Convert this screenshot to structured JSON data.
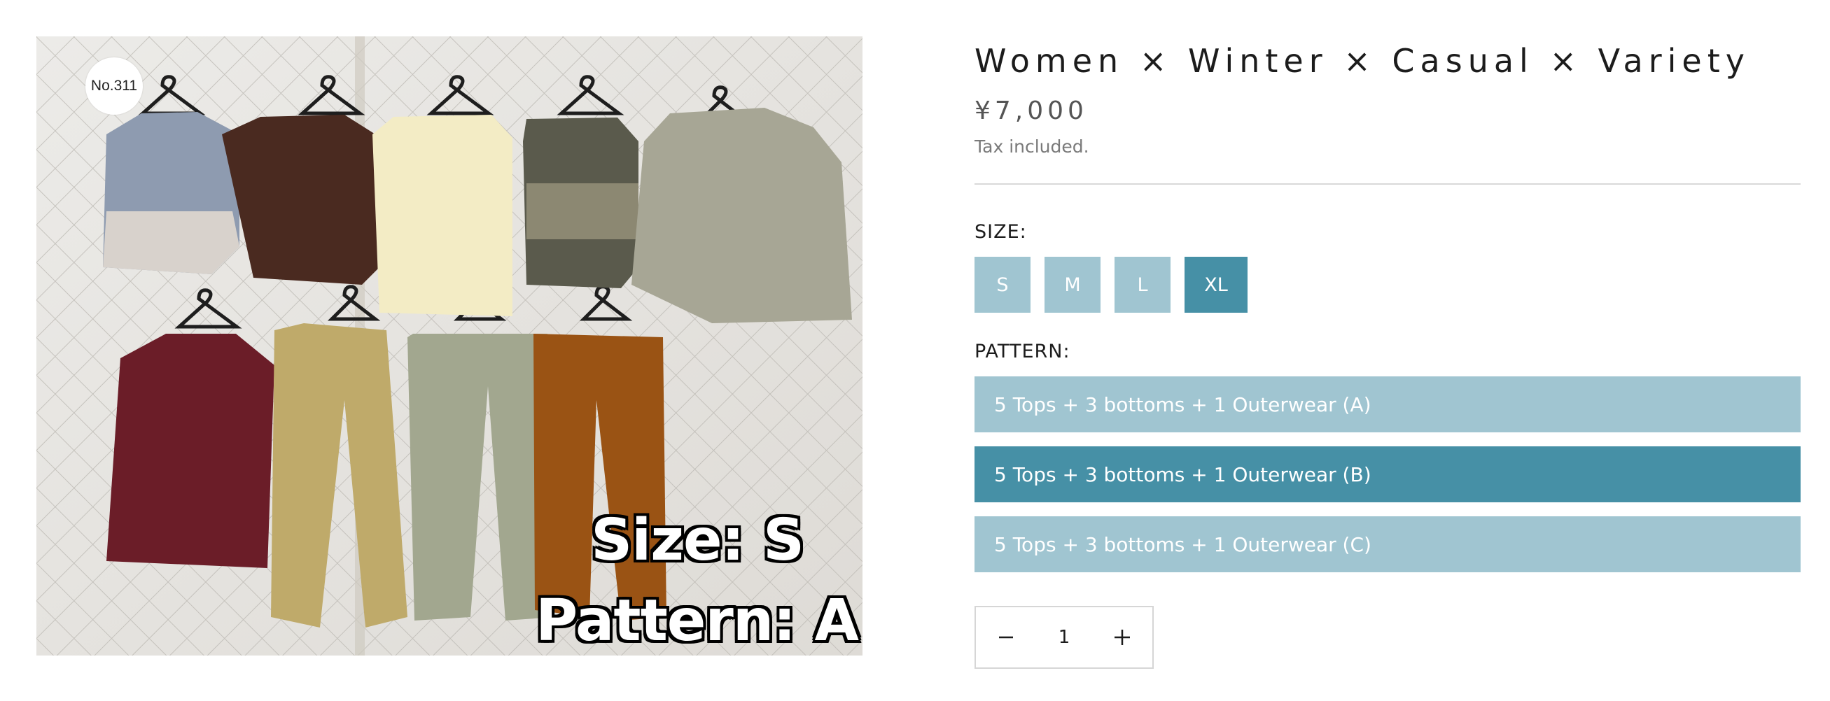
{
  "image": {
    "badge": "No.311",
    "overlay_size": "Size: S",
    "overlay_pattern": "Pattern: A"
  },
  "product": {
    "title": "Women × Winter × Casual × Variety",
    "price": "¥7,000",
    "tax_note": "Tax included."
  },
  "size_option": {
    "label": "SIZE:",
    "options": [
      "S",
      "M",
      "L",
      "XL"
    ],
    "selected": "XL"
  },
  "pattern_option": {
    "label": "PATTERN:",
    "options": [
      "5 Tops + 3 bottoms + 1 Outerwear (A)",
      "5 Tops + 3 bottoms + 1 Outerwear (B)",
      "5 Tops + 3 bottoms + 1 Outerwear (C)"
    ],
    "selected": "5 Tops + 3 bottoms + 1 Outerwear (B)"
  },
  "quantity": {
    "value": "1",
    "decrease_icon": "minus-icon",
    "increase_icon": "plus-icon"
  },
  "colors": {
    "option_default": "#a0c5d1",
    "option_selected": "#4690a6"
  }
}
